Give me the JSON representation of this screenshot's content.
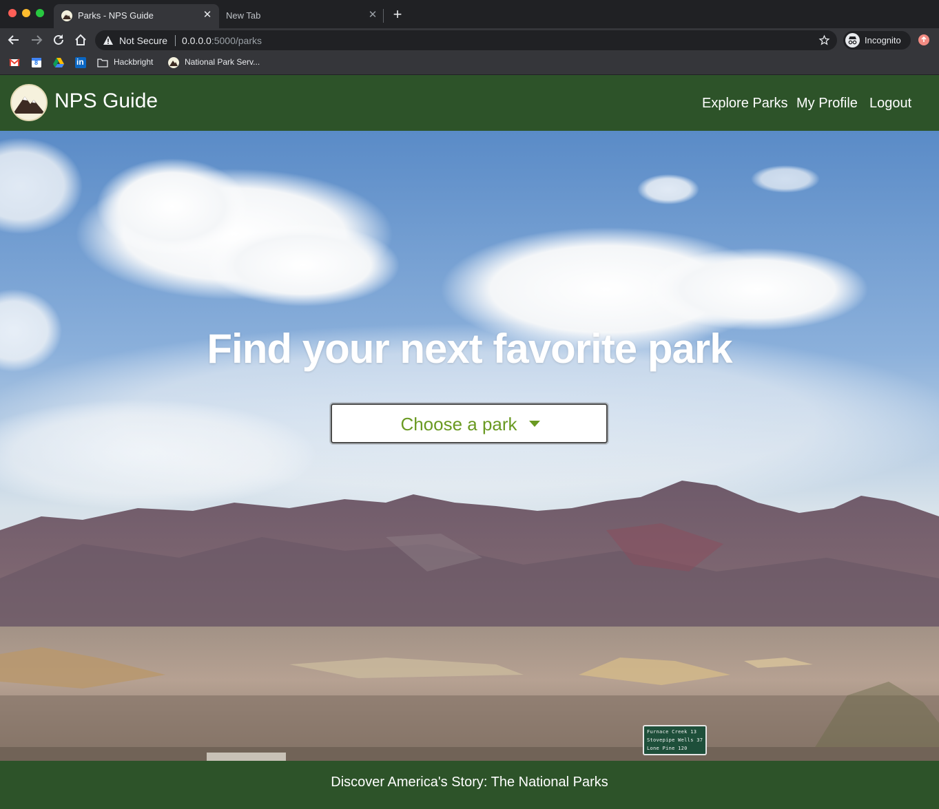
{
  "browser": {
    "tabs": [
      {
        "title": "Parks - NPS Guide",
        "active": true,
        "close": "✕"
      },
      {
        "title": "New Tab",
        "active": false,
        "close": "✕"
      }
    ],
    "new_tab_glyph": "+",
    "security_label": "Not Secure",
    "url_host": "0.0.0.0",
    "url_rest": ":5000/parks",
    "profile_label": "Incognito",
    "bookmarks": [
      {
        "icon": "gmail-icon",
        "label": ""
      },
      {
        "icon": "calendar-icon",
        "label": "8"
      },
      {
        "icon": "drive-icon",
        "label": ""
      },
      {
        "icon": "linkedin-icon",
        "label": "in"
      },
      {
        "icon": "folder-icon",
        "label": "Hackbright"
      },
      {
        "icon": "nps-favicon-icon",
        "label": "National Park Serv..."
      }
    ]
  },
  "navbar": {
    "brand": "NPS Guide",
    "links": [
      "Explore Parks",
      "My Profile",
      "Logout"
    ],
    "color": "#2d5329"
  },
  "hero": {
    "title": "Find your next favorite park",
    "dropdown_label": "Choose a park",
    "accent": "#6a9a22",
    "sign": [
      "Furnace Creek  13",
      "Stovepipe Wells 37",
      "Lone Pine     120"
    ]
  },
  "footer": {
    "text": "Discover America's Story: The National Parks"
  }
}
